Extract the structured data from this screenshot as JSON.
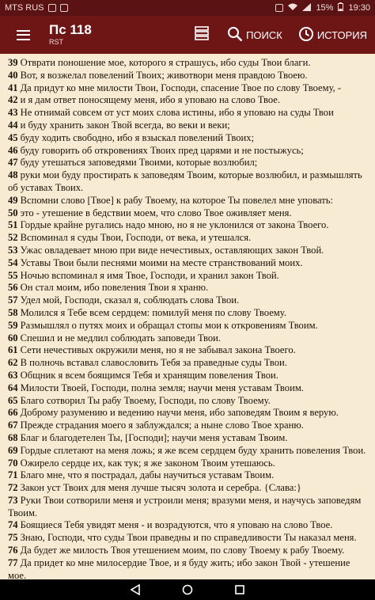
{
  "status": {
    "carrier": "MTS RUS",
    "battery": "15%",
    "time": "19:30"
  },
  "appbar": {
    "title": "Пс 118",
    "subtitle": "RST",
    "search_label": "ПОИСК",
    "history_label": "ИСТОРИЯ"
  },
  "verses": [
    {
      "n": "39",
      "t": "Отврати поношение мое, которого я страшусь, ибо суды Твои благи."
    },
    {
      "n": "40",
      "t": "Вот, я возжелал повелений Твоих; животвори меня правдою Твоею."
    },
    {
      "n": "41",
      "t": "Да придут ко мне милости Твои, Господи, спасение Твое по слову Твоему, -"
    },
    {
      "n": "42",
      "t": "и я дам ответ поносящему меня, ибо я уповаю на слово Твое."
    },
    {
      "n": "43",
      "t": "Не отнимай совсем от уст моих слова истины, ибо я уповаю на суды Твои"
    },
    {
      "n": "44",
      "t": "и буду хранить закон Твой всегда, во веки и веки;"
    },
    {
      "n": "45",
      "t": "буду ходить свободно, ибо я взыскал повелений Твоих;"
    },
    {
      "n": "46",
      "t": "буду говорить об откровениях Твоих пред царями и не постыжусь;"
    },
    {
      "n": "47",
      "t": "буду утешаться заповедями Твоими, которые возлюбил;"
    },
    {
      "n": "48",
      "t": "руки мои буду простирать к заповедям Твоим, которые возлюбил, и размышлять об уставах Твоих."
    },
    {
      "n": "49",
      "t": "Вспомни слово [Твое] к рабу Твоему, на которое Ты повелел мне уповать:"
    },
    {
      "n": "50",
      "t": "это - утешение в бедствии моем, что слово Твое оживляет меня."
    },
    {
      "n": "51",
      "t": "Гордые крайне ругались надо мною, но я не уклонился от закона Твоего."
    },
    {
      "n": "52",
      "t": "Вспоминал я суды Твои, Господи, от века, и утешался."
    },
    {
      "n": "53",
      "t": "Ужас овладевает мною при виде нечестивых, оставляющих закон Твой."
    },
    {
      "n": "54",
      "t": "Уставы Твои были песнями моими на месте странствований моих."
    },
    {
      "n": "55",
      "t": "Ночью вспоминал я имя Твое, Господи, и хранил закон Твой."
    },
    {
      "n": "56",
      "t": "Он стал моим, ибо повеления Твои я храню."
    },
    {
      "n": "57",
      "t": "Удел мой, Господи, сказал я, соблюдать слова Твои."
    },
    {
      "n": "58",
      "t": "Молился я Тебе всем сердцем: помилуй меня по слову Твоему."
    },
    {
      "n": "59",
      "t": "Размышлял о путях моих и обращал стопы мои к откровениям Твоим."
    },
    {
      "n": "60",
      "t": "Спешил и не медлил соблюдать заповеди Твои."
    },
    {
      "n": "61",
      "t": "Сети нечестивых окружили меня, но я не забывал закона Твоего."
    },
    {
      "n": "62",
      "t": "В полночь вставал славословить Тебя за праведные суды Твои."
    },
    {
      "n": "63",
      "t": "Общник я всем боящимся Тебя и хранящим повеления Твои."
    },
    {
      "n": "64",
      "t": "Милости Твоей, Господи, полна земля; научи меня уставам Твоим."
    },
    {
      "n": "65",
      "t": "Благо сотворил Ты рабу Твоему, Господи, по слову Твоему."
    },
    {
      "n": "66",
      "t": "Доброму разумению и ведению научи меня, ибо заповедям Твоим я верую."
    },
    {
      "n": "67",
      "t": "Прежде страдания моего я заблуждался; а ныне слово Твое храню."
    },
    {
      "n": "68",
      "t": "Благ и благодетелен Ты, [Господи]; научи меня уставам Твоим."
    },
    {
      "n": "69",
      "t": "Гордые сплетают на меня ложь; я же всем сердцем буду хранить повеления Твои."
    },
    {
      "n": "70",
      "t": "Ожирело сердце их, как тук; я же законом Твоим утешаюсь."
    },
    {
      "n": "71",
      "t": "Благо мне, что я пострадал, дабы научиться уставам Твоим."
    },
    {
      "n": "72",
      "t": "Закон уст Твоих для меня лучше тысяч золота и серебра. {Слава:}"
    },
    {
      "n": "73",
      "t": "Руки Твои сотворили меня и устроили меня; вразуми меня, и научусь заповедям Твоим."
    },
    {
      "n": "74",
      "t": "Боящиеся Тебя увидят меня - и возрадуются, что я уповаю на слово Твое."
    },
    {
      "n": "75",
      "t": "Знаю, Господи, что суды Твои праведны и по справедливости Ты наказал меня."
    },
    {
      "n": "76",
      "t": "Да будет же милость Твоя утешением моим, по слову Твоему к рабу Твоему."
    },
    {
      "n": "77",
      "t": "Да придет ко мне милосердие Твое, и я буду жить; ибо закон Твой - утешение мое."
    }
  ]
}
